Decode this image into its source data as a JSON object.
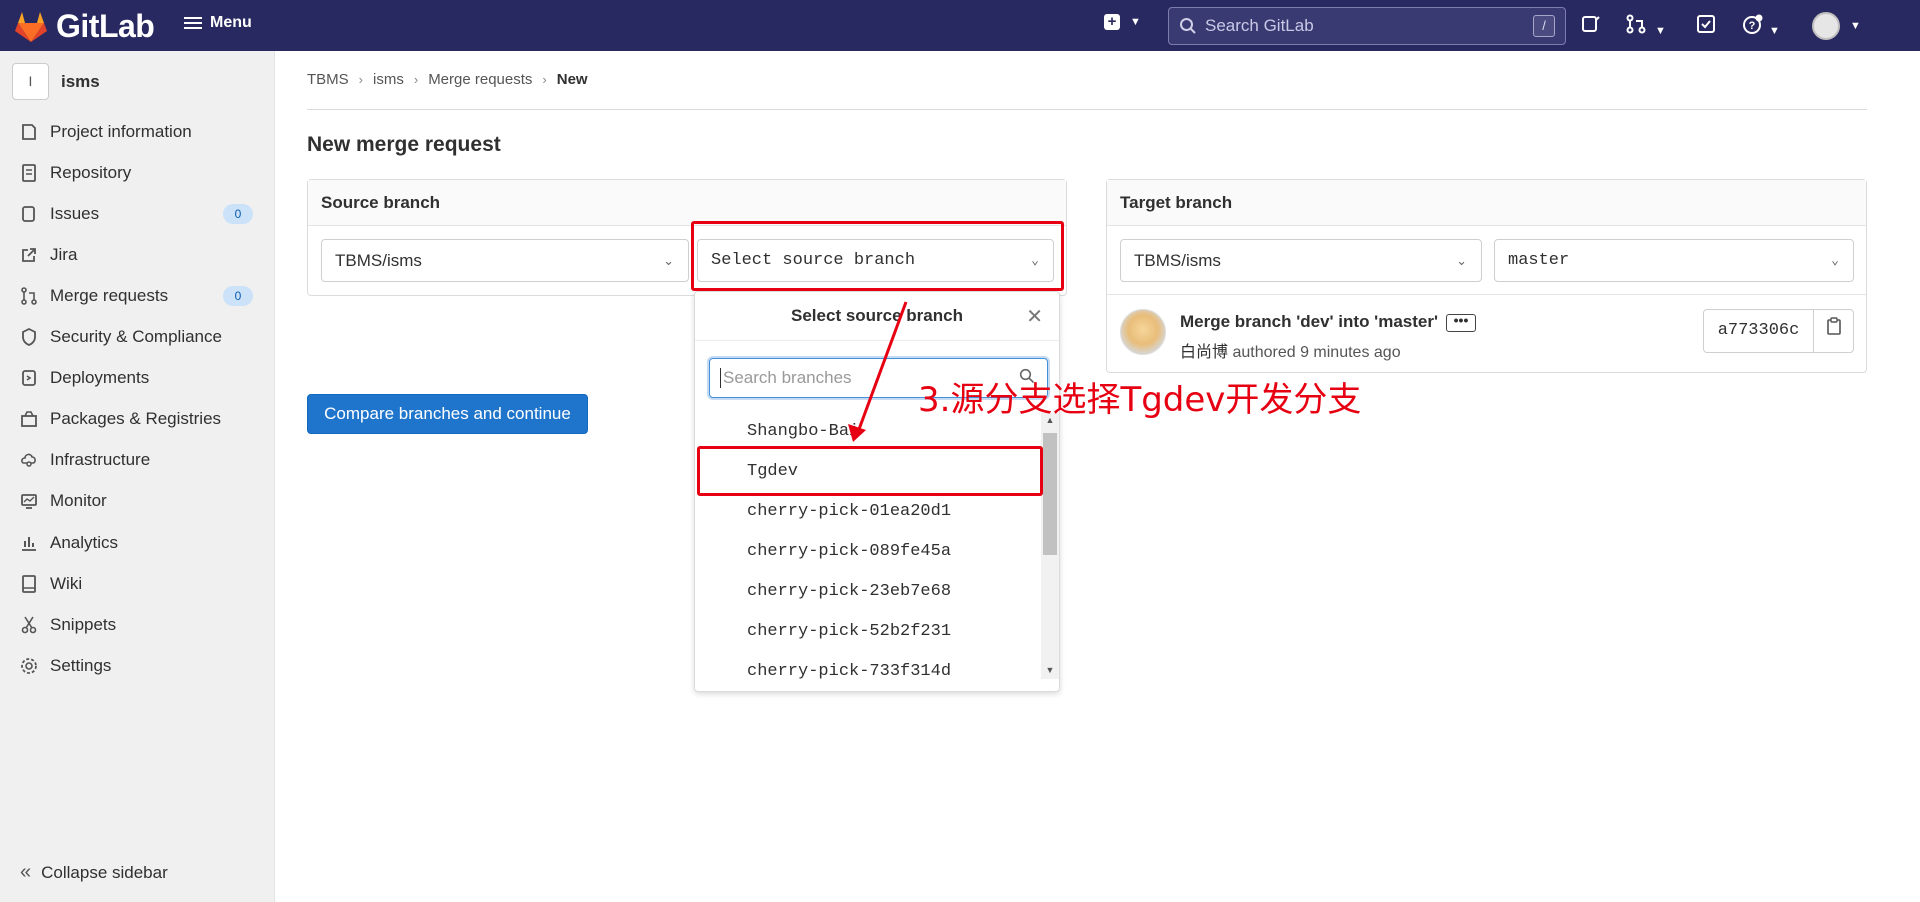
{
  "topbar": {
    "logo_text": "GitLab",
    "menu_label": "Menu",
    "search_placeholder": "Search GitLab",
    "search_shortcut": "/"
  },
  "sidebar": {
    "project_initial": "I",
    "project_name": "isms",
    "items": [
      {
        "label": "Project information",
        "icon": "project-info-icon"
      },
      {
        "label": "Repository",
        "icon": "repository-icon"
      },
      {
        "label": "Issues",
        "icon": "issues-icon",
        "count": "0"
      },
      {
        "label": "Jira",
        "icon": "external-link-icon"
      },
      {
        "label": "Merge requests",
        "icon": "merge-request-icon",
        "count": "0"
      },
      {
        "label": "Security & Compliance",
        "icon": "shield-icon"
      },
      {
        "label": "Deployments",
        "icon": "deployments-icon"
      },
      {
        "label": "Packages & Registries",
        "icon": "package-icon"
      },
      {
        "label": "Infrastructure",
        "icon": "infrastructure-icon"
      },
      {
        "label": "Monitor",
        "icon": "monitor-icon"
      },
      {
        "label": "Analytics",
        "icon": "analytics-icon"
      },
      {
        "label": "Wiki",
        "icon": "book-icon"
      },
      {
        "label": "Snippets",
        "icon": "snippet-icon"
      },
      {
        "label": "Settings",
        "icon": "gear-icon"
      }
    ],
    "collapse_label": "Collapse sidebar"
  },
  "breadcrumb": [
    "TBMS",
    "isms",
    "Merge requests",
    "New"
  ],
  "page_title": "New merge request",
  "source": {
    "heading": "Source branch",
    "project_value": "TBMS/isms",
    "branch_placeholder": "Select source branch"
  },
  "target": {
    "heading": "Target branch",
    "project_value": "TBMS/isms",
    "branch_value": "master",
    "commit_title": "Merge branch 'dev' into 'master'",
    "commit_more": "•••",
    "commit_author": "白尚博",
    "commit_time": "authored 9 minutes ago",
    "commit_sha": "a773306c"
  },
  "compare_button": "Compare branches and continue",
  "branch_menu": {
    "title": "Select source branch",
    "search_placeholder": "Search branches",
    "branches": [
      "Shangbo-Bai",
      "Tgdev",
      "cherry-pick-01ea20d1",
      "cherry-pick-089fe45a",
      "cherry-pick-23eb7e68",
      "cherry-pick-52b2f231",
      "cherry-pick-733f314d"
    ]
  },
  "annotation": {
    "text": "3.源分支选择Tgdev开发分支",
    "color": "#e60012"
  },
  "colors": {
    "navbar": "#292961",
    "primary": "#1f75cb",
    "annotation": "#e60012"
  }
}
